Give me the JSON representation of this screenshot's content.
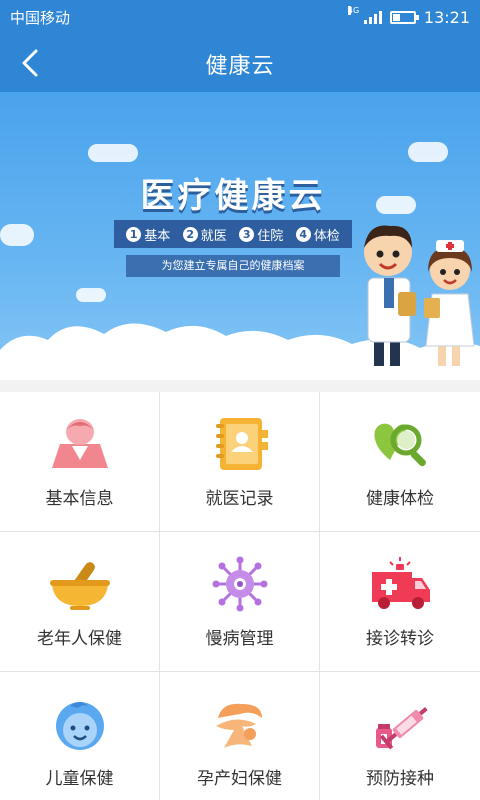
{
  "status_bar": {
    "carrier": "中国移动",
    "network": "4G",
    "time": "13:21",
    "battery_level": 0.35,
    "signal_bars": 4
  },
  "nav": {
    "back_icon": "chevron-left-icon",
    "title": "健康云"
  },
  "banner": {
    "headline": "医疗健康云",
    "steps": [
      {
        "num": "1",
        "label": "基本"
      },
      {
        "num": "2",
        "label": "就医"
      },
      {
        "num": "3",
        "label": "住院"
      },
      {
        "num": "4",
        "label": "体检"
      }
    ],
    "tagline": "为您建立专属自己的健康档案",
    "sky_color": "#4aa3ec"
  },
  "grid": {
    "items": [
      {
        "label": "基本信息",
        "icon": "person-profile-icon",
        "color": "#f2868f"
      },
      {
        "label": "就医记录",
        "icon": "medical-record-book-icon",
        "color": "#f5b333"
      },
      {
        "label": "健康体检",
        "icon": "heart-magnifier-icon",
        "color": "#8cc63e"
      },
      {
        "label": "老年人保健",
        "icon": "mortar-pestle-icon",
        "color": "#f5b733"
      },
      {
        "label": "慢病管理",
        "icon": "virus-icon",
        "color": "#b571e0"
      },
      {
        "label": "接诊转诊",
        "icon": "ambulance-icon",
        "color": "#ef3b55"
      },
      {
        "label": "儿童保健",
        "icon": "baby-face-icon",
        "color": "#5aa8f0"
      },
      {
        "label": "孕产妇保健",
        "icon": "mother-icon",
        "color": "#f5a05a"
      },
      {
        "label": "预防接种",
        "icon": "vaccine-syringe-icon",
        "color": "#e85a8a"
      }
    ]
  }
}
